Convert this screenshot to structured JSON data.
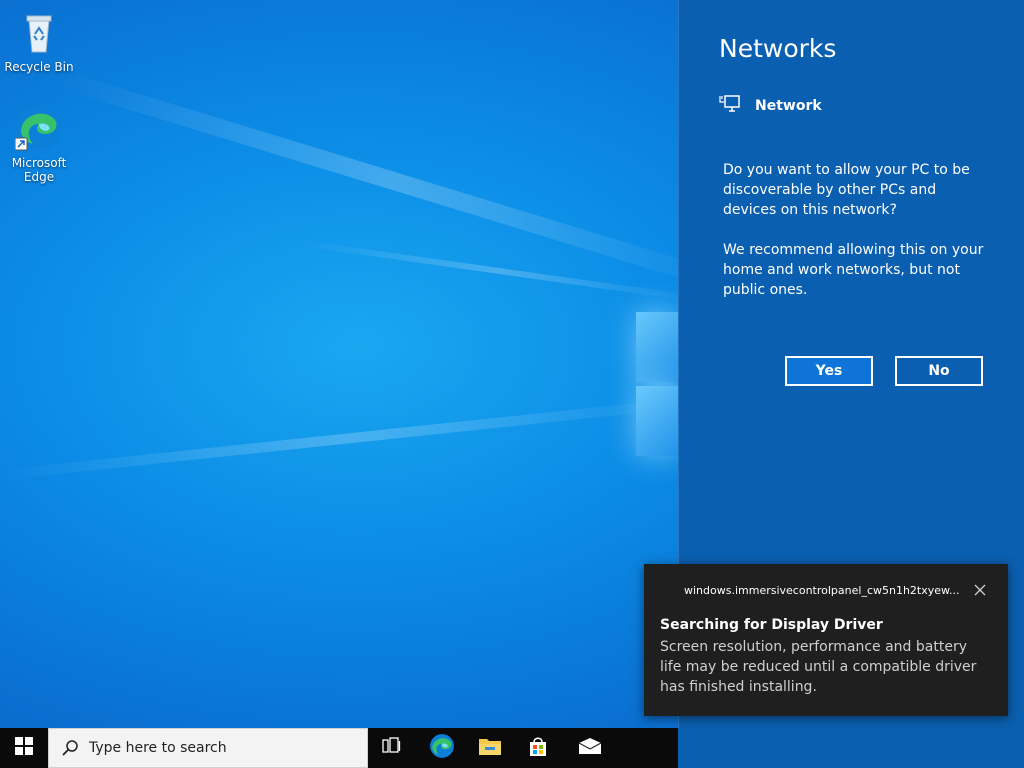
{
  "desktop": {
    "icons": [
      {
        "label": "Recycle Bin",
        "icon": "recycle-bin-icon"
      },
      {
        "label": "Microsoft Edge",
        "icon": "edge-icon"
      }
    ]
  },
  "networks_flyout": {
    "title": "Networks",
    "network_name": "Network",
    "network_icon": "network-icon",
    "question": "Do you want to allow your PC to be discoverable by other PCs and devices on this network?",
    "recommendation": "We recommend allowing this on your home and work networks, but not public ones.",
    "yes_label": "Yes",
    "no_label": "No",
    "background_color": "#0b5fb0",
    "yes_button_color": "#0f74d8"
  },
  "toast": {
    "app_name": "windows.immersivecontrolpanel_cw5n1h2txyew...",
    "title": "Searching for Display Driver",
    "body": "Screen resolution, performance and battery life may be reduced until a compatible driver has finished installing.",
    "close_icon": "close-icon"
  },
  "taskbar": {
    "search_placeholder": "Type here to search",
    "items": [
      "windows-start-icon",
      "search-icon",
      "task-view-icon",
      "edge-icon",
      "file-explorer-icon",
      "store-icon",
      "mail-icon"
    ]
  }
}
